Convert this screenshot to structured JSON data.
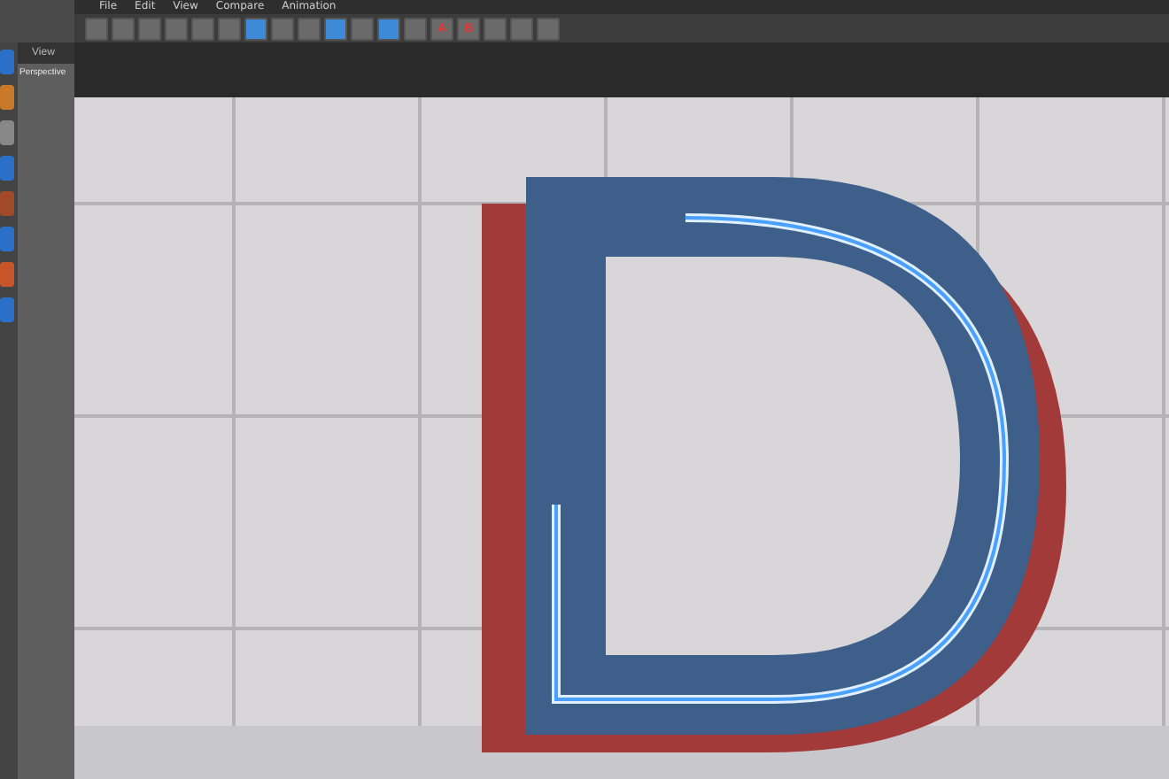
{
  "menu": [
    "File",
    "Edit",
    "View",
    "Compare",
    "Animation"
  ],
  "toolbar": [
    {
      "selected": false
    },
    {
      "selected": false
    },
    {
      "selected": false
    },
    {
      "selected": false
    },
    {
      "selected": false
    },
    {
      "selected": false
    },
    {
      "selected": true
    },
    {
      "selected": false
    },
    {
      "selected": false
    },
    {
      "selected": true
    },
    {
      "selected": false
    },
    {
      "selected": true
    },
    {
      "selected": false
    },
    {
      "selected": false,
      "label": "A"
    },
    {
      "selected": false,
      "label": "B"
    },
    {
      "selected": false
    },
    {
      "selected": false
    },
    {
      "selected": false
    }
  ],
  "viewport": {
    "tab": "View",
    "camera": "Perspective"
  }
}
